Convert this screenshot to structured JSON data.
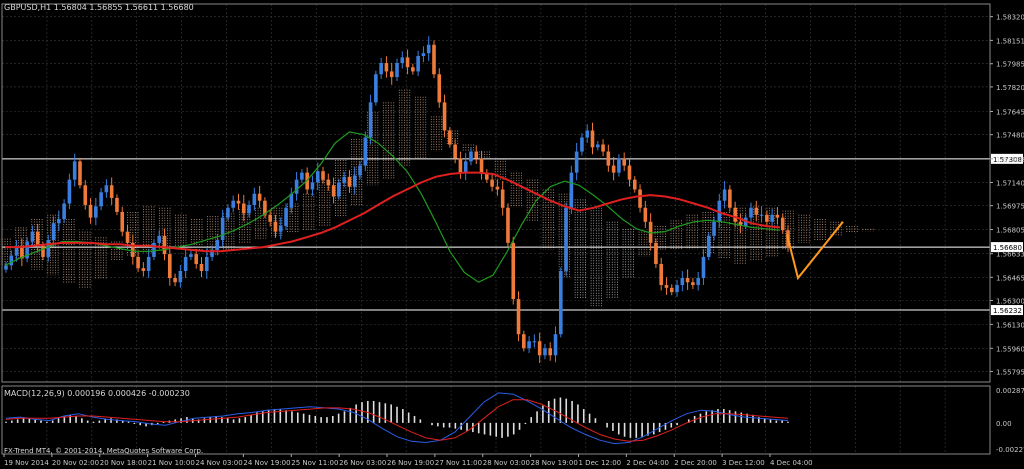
{
  "window": {
    "symbol_header": "GBPUSD,H1  1.56804 1.56855 1.56611 1.56680",
    "copyright": "FX-Trend MT4, © 2001-2014, MetaQuotes Software Corp."
  },
  "colors": {
    "background": "#000000",
    "grid": "#3a3a3a",
    "axis_text": "#c8c8c8",
    "bull": "#3a7fe0",
    "bear": "#f07a3a",
    "ma_red": "#e02020",
    "ma_green": "#1e9a1e",
    "cloud_a": "#e8b89a",
    "cloud_b": "#d8d8d8",
    "hline": "#ffffff",
    "zigzag": "#ff9a1e",
    "macd_hist": "#e0e0e0",
    "macd_line": "#2a5ee8",
    "signal_line": "#e02020",
    "arrow_up": "#30e030",
    "arrow_down": "#ff2020"
  },
  "chart_data": {
    "type": "candlestick",
    "title": "GBPUSD,H1",
    "ohlc_readout": {
      "open": 1.56804,
      "high": 1.56855,
      "low": 1.56611,
      "close": 1.5668
    },
    "ylim": [
      1.5572,
      1.5841
    ],
    "y_ticks": [
      "1.58320",
      "1.58151",
      "1.57985",
      "1.57820",
      "1.57645",
      "1.57480",
      "1.57308",
      "1.57140",
      "1.56975",
      "1.56805",
      "1.56633",
      "1.56465",
      "1.56300",
      "1.56130",
      "1.55960",
      "1.55795"
    ],
    "x_ticks": [
      "19 Nov 2014",
      "20 Nov 02:00",
      "20 Nov 18:00",
      "21 Nov 10:00",
      "24 Nov 03:00",
      "24 Nov 19:00",
      "25 Nov 11:00",
      "26 Nov 03:00",
      "26 Nov 19:00",
      "27 Nov 11:00",
      "28 Nov 03:00",
      "28 Nov 19:00",
      "1 Dec 12:00",
      "2 Dec 04:00",
      "2 Dec 20:00",
      "3 Dec 12:00",
      "4 Dec 04:00"
    ],
    "horizontal_lines": [
      {
        "value": 1.57308,
        "label": "1.57308"
      },
      {
        "value": 1.5668,
        "label": "1.56680"
      },
      {
        "value": 1.56232,
        "label": "1.56232"
      }
    ],
    "close_path": [
      1.5655,
      1.5662,
      1.5668,
      1.566,
      1.5672,
      1.5679,
      1.5669,
      1.5661,
      1.5673,
      1.5685,
      1.5688,
      1.5699,
      1.5716,
      1.5729,
      1.5712,
      1.5698,
      1.5689,
      1.5697,
      1.5707,
      1.5712,
      1.5703,
      1.5693,
      1.5679,
      1.5671,
      1.5661,
      1.5653,
      1.5651,
      1.5661,
      1.5671,
      1.5676,
      1.5663,
      1.5646,
      1.5643,
      1.5651,
      1.5661,
      1.5663,
      1.5656,
      1.5651,
      1.5661,
      1.5666,
      1.5673,
      1.5689,
      1.5696,
      1.5701,
      1.5699,
      1.5692,
      1.5698,
      1.5706,
      1.5701,
      1.5691,
      1.5686,
      1.5679,
      1.5683,
      1.5696,
      1.5706,
      1.5716,
      1.5721,
      1.5709,
      1.5714,
      1.5722,
      1.5716,
      1.5712,
      1.5704,
      1.5714,
      1.5718,
      1.5711,
      1.5719,
      1.5726,
      1.5746,
      1.5771,
      1.5791,
      1.5799,
      1.5793,
      1.5789,
      1.5799,
      1.5803,
      1.5796,
      1.5793,
      1.5804,
      1.5806,
      1.5812,
      1.5791,
      1.5771,
      1.5751,
      1.5741,
      1.5731,
      1.5721,
      1.5729,
      1.5736,
      1.5731,
      1.5721,
      1.5716,
      1.5711,
      1.5709,
      1.5696,
      1.5671,
      1.5631,
      1.5606,
      1.5596,
      1.5601,
      1.5601,
      1.5591,
      1.5596,
      1.5591,
      1.5606,
      1.5651,
      1.5696,
      1.5721,
      1.5736,
      1.5746,
      1.5751,
      1.5739,
      1.5741,
      1.5736,
      1.5726,
      1.5721,
      1.5731,
      1.5726,
      1.5716,
      1.5709,
      1.5696,
      1.5686,
      1.5671,
      1.5656,
      1.5641,
      1.5639,
      1.5636,
      1.5641,
      1.5646,
      1.5643,
      1.5641,
      1.5646,
      1.5661,
      1.5676,
      1.5686,
      1.5701,
      1.5709,
      1.5696,
      1.5686,
      1.5683,
      1.5689,
      1.5696,
      1.5691,
      1.5691,
      1.5686,
      1.5691,
      1.5689,
      1.568,
      1.5668
    ],
    "ma_red": [
      1.5668,
      1.5668,
      1.5669,
      1.567,
      1.5671,
      1.5671,
      1.5671,
      1.567,
      1.567,
      1.5669,
      1.5669,
      1.5668,
      1.5667,
      1.5666,
      1.5665,
      1.5665,
      1.5666,
      1.5667,
      1.5668,
      1.567,
      1.5672,
      1.5675,
      1.5678,
      1.5682,
      1.5687,
      1.5692,
      1.5698,
      1.5704,
      1.5709,
      1.5714,
      1.5718,
      1.572,
      1.5721,
      1.5721,
      1.572,
      1.5716,
      1.5711,
      1.5706,
      1.5701,
      1.5697,
      1.5694,
      1.5696,
      1.5699,
      1.5702,
      1.5704,
      1.5705,
      1.5704,
      1.5702,
      1.5699,
      1.5696,
      1.5692,
      1.5689,
      1.5685,
      1.5683,
      1.5682
    ],
    "ma_green": [
      1.5655,
      1.566,
      1.5664,
      1.5668,
      1.5672,
      1.5672,
      1.5671,
      1.5669,
      1.5667,
      1.5665,
      1.5665,
      1.5666,
      1.5668,
      1.567,
      1.5673,
      1.5676,
      1.568,
      1.5685,
      1.5691,
      1.5698,
      1.5706,
      1.5715,
      1.5727,
      1.5742,
      1.575,
      1.5748,
      1.5742,
      1.5733,
      1.5722,
      1.5706,
      1.5686,
      1.5665,
      1.565,
      1.5643,
      1.5648,
      1.5665,
      1.5684,
      1.5701,
      1.5711,
      1.5715,
      1.5712,
      1.5705,
      1.5697,
      1.5688,
      1.5681,
      1.5678,
      1.5679,
      1.5683,
      1.5686,
      1.5687,
      1.5686,
      1.5684,
      1.5682,
      1.5681,
      1.568
    ],
    "cloud": [
      [
        1.5655,
        1.5674
      ],
      [
        1.566,
        1.5682
      ],
      [
        1.5652,
        1.5688
      ],
      [
        1.5648,
        1.5691
      ],
      [
        1.5642,
        1.5688
      ],
      [
        1.5638,
        1.5679
      ],
      [
        1.5645,
        1.5675
      ],
      [
        1.5658,
        1.5672
      ],
      [
        1.5662,
        1.5693
      ],
      [
        1.5664,
        1.5697
      ],
      [
        1.5666,
        1.5696
      ],
      [
        1.5668,
        1.5691
      ],
      [
        1.5665,
        1.5688
      ],
      [
        1.5662,
        1.569
      ],
      [
        1.5666,
        1.5692
      ],
      [
        1.567,
        1.5695
      ],
      [
        1.5674,
        1.5696
      ],
      [
        1.5676,
        1.5696
      ],
      [
        1.5678,
        1.5699
      ],
      [
        1.568,
        1.5706
      ],
      [
        1.5683,
        1.5716
      ],
      [
        1.5689,
        1.573
      ],
      [
        1.5698,
        1.5745
      ],
      [
        1.5712,
        1.5764
      ],
      [
        1.5716,
        1.5771
      ],
      [
        1.5726,
        1.578
      ],
      [
        1.5731,
        1.5775
      ],
      [
        1.5736,
        1.5761
      ],
      [
        1.5741,
        1.5751
      ],
      [
        1.5736,
        1.5741
      ],
      [
        1.5731,
        1.5736
      ],
      [
        1.5716,
        1.5731
      ],
      [
        1.5696,
        1.5721
      ],
      [
        1.5686,
        1.5716
      ],
      [
        1.5666,
        1.5709
      ],
      [
        1.5646,
        1.5706
      ],
      [
        1.5631,
        1.5702
      ],
      [
        1.5626,
        1.5696
      ],
      [
        1.5631,
        1.5686
      ],
      [
        1.5646,
        1.5681
      ],
      [
        1.5661,
        1.5679
      ],
      [
        1.5666,
        1.5683
      ],
      [
        1.5666,
        1.5687
      ],
      [
        1.5666,
        1.5691
      ],
      [
        1.5663,
        1.5693
      ],
      [
        1.566,
        1.5693
      ],
      [
        1.5656,
        1.5696
      ],
      [
        1.5658,
        1.5697
      ],
      [
        1.5661,
        1.5696
      ],
      [
        1.5666,
        1.5694
      ],
      [
        1.5671,
        1.5691
      ],
      [
        1.5673,
        1.5688
      ],
      [
        1.5676,
        1.5686
      ],
      [
        1.5678,
        1.5683
      ],
      [
        1.5679,
        1.5681
      ]
    ],
    "zigzag": [
      [
        1.5677,
        1.5646
      ],
      [
        1.5646,
        1.5686
      ]
    ],
    "macd": {
      "label": "MACD(12,26,9) 0.000196 0.000426 -0.000230",
      "ylim": [
        -0.0027,
        0.0032
      ],
      "y_ticks": [
        "0.002871",
        "0.00",
        "-0.002272"
      ],
      "hist": [
        0.0001,
        0.0002,
        0.0003,
        0.0004,
        0.0004,
        0.0003,
        0.0002,
        0.0001,
        0.0002,
        0.0004,
        0.0006,
        0.0007,
        0.0006,
        0.0004,
        0.0002,
        0.0001,
        0.0002,
        0.0003,
        0.0004,
        0.0003,
        0.0002,
        0.0001,
        -0.0001,
        -0.0002,
        -0.0003,
        -0.0002,
        -0.0001,
        0.0001,
        0.0002,
        0.0003,
        0.0004,
        0.0005,
        0.0004,
        0.0003,
        0.0004,
        0.0005,
        0.0006,
        0.0005,
        0.0004,
        0.0003,
        0.0004,
        0.0005,
        0.0007,
        0.0009,
        0.001,
        0.0011,
        0.0012,
        0.0012,
        0.0011,
        0.001,
        0.0009,
        0.0008,
        0.0007,
        0.0006,
        0.0005,
        0.0005,
        0.0006,
        0.0008,
        0.001,
        0.0013,
        0.0016,
        0.0018,
        0.0019,
        0.0019,
        0.0018,
        0.0017,
        0.0016,
        0.0014,
        0.0012,
        0.0009,
        0.0006,
        0.0003,
        0.0,
        -0.0002,
        -0.0003,
        -0.0004,
        -0.0004,
        -0.0005,
        -0.0006,
        -0.0007,
        -0.0008,
        -0.0009,
        -0.001,
        -0.0011,
        -0.0012,
        -0.0013,
        -0.0012,
        -0.001,
        -0.0006,
        -0.0001,
        0.0005,
        0.001,
        0.0015,
        0.0019,
        0.0021,
        0.0022,
        0.0021,
        0.0019,
        0.0016,
        0.0012,
        0.0008,
        0.0004,
        0.0,
        -0.0004,
        -0.0007,
        -0.001,
        -0.0012,
        -0.0013,
        -0.0013,
        -0.0012,
        -0.0011,
        -0.001,
        -0.0008,
        -0.0006,
        -0.0004,
        -0.0002,
        0.0,
        0.0003,
        0.0006,
        0.0008,
        0.001,
        0.0011,
        0.0012,
        0.0012,
        0.0011,
        0.001,
        0.0009,
        0.0008,
        0.0007,
        0.0005,
        0.0004,
        0.0003,
        0.0002,
        0.0002,
        0.0001
      ],
      "macd_line": [
        0.0004,
        0.0005,
        0.0003,
        0.0002,
        0.0006,
        0.0008,
        0.0005,
        0.0003,
        0.0002,
        0.0001,
        -0.0001,
        -0.0002,
        0.0001,
        0.0004,
        0.0005,
        0.0006,
        0.0008,
        0.0009,
        0.0011,
        0.0012,
        0.0013,
        0.0014,
        0.0013,
        0.0012,
        0.0009,
        0.0003,
        -0.0005,
        -0.0012,
        -0.0016,
        -0.0017,
        -0.0015,
        -0.0008,
        0.0005,
        0.0018,
        0.0026,
        0.0025,
        0.0019,
        0.0012,
        0.0004,
        -0.0004,
        -0.001,
        -0.0015,
        -0.0018,
        -0.0017,
        -0.0012,
        -0.0005,
        0.0002,
        0.0008,
        0.0011,
        0.001,
        0.0007,
        0.0005,
        0.0004,
        0.0003,
        0.0002
      ],
      "signal_line": [
        0.0003,
        0.0004,
        0.0004,
        0.0004,
        0.0005,
        0.0006,
        0.0006,
        0.0005,
        0.0004,
        0.0003,
        0.0002,
        0.0001,
        0.0001,
        0.0002,
        0.0003,
        0.0004,
        0.0005,
        0.0007,
        0.0009,
        0.001,
        0.0011,
        0.0012,
        0.0013,
        0.0013,
        0.0012,
        0.0009,
        0.0004,
        -0.0002,
        -0.0008,
        -0.0013,
        -0.0015,
        -0.0013,
        -0.0006,
        0.0004,
        0.0014,
        0.002,
        0.002,
        0.0016,
        0.001,
        0.0003,
        -0.0004,
        -0.001,
        -0.0014,
        -0.0016,
        -0.0015,
        -0.0011,
        -0.0006,
        0.0,
        0.0005,
        0.0008,
        0.0008,
        0.0007,
        0.0006,
        0.0005,
        0.0004
      ]
    }
  }
}
